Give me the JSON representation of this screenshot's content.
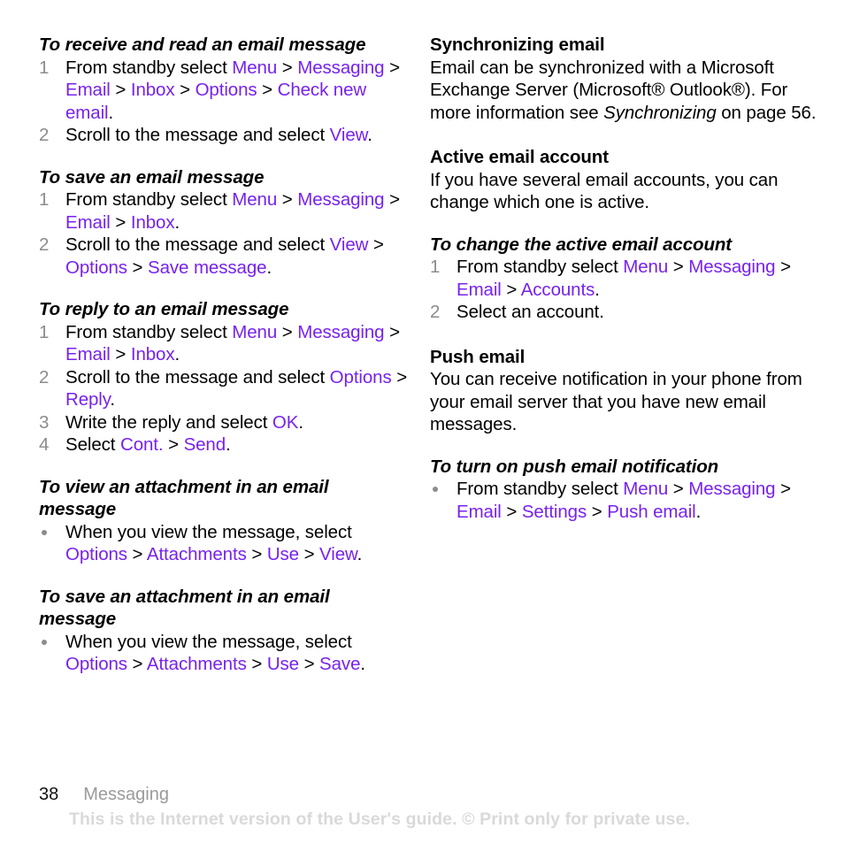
{
  "page": {
    "number": "38",
    "chapter": "Messaging",
    "watermark": "This is the Internet version of the User's guide. © Print only for private use."
  },
  "colors": {
    "menu_item": "#7722ee",
    "step_number": "#8c8c8c",
    "chapter_gray": "#9a9a9a",
    "watermark_gray": "#d9d9d9",
    "body_text": "#000000"
  },
  "left_column": {
    "sections": [
      {
        "heading": "To receive and read an email message",
        "heading_style": "bold-italic",
        "list_type": "ordered",
        "steps": [
          {
            "number": "1",
            "parts": [
              {
                "t": "From standby select ",
                "k": "plain"
              },
              {
                "t": "Menu",
                "k": "menu"
              },
              {
                "t": " > ",
                "k": "sep"
              },
              {
                "t": "Messaging",
                "k": "menu"
              },
              {
                "t": " > ",
                "k": "sep"
              },
              {
                "t": "Email",
                "k": "menu"
              },
              {
                "t": " > ",
                "k": "sep"
              },
              {
                "t": "Inbox",
                "k": "menu"
              },
              {
                "t": " > ",
                "k": "sep"
              },
              {
                "t": "Options",
                "k": "menu"
              },
              {
                "t": " > ",
                "k": "sep"
              },
              {
                "t": "Check new email",
                "k": "menu"
              },
              {
                "t": ".",
                "k": "plain"
              }
            ]
          },
          {
            "number": "2",
            "parts": [
              {
                "t": "Scroll to the message and select ",
                "k": "plain"
              },
              {
                "t": "View",
                "k": "menu"
              },
              {
                "t": ".",
                "k": "plain"
              }
            ]
          }
        ]
      },
      {
        "heading": "To save an email message",
        "heading_style": "bold-italic",
        "list_type": "ordered",
        "steps": [
          {
            "number": "1",
            "parts": [
              {
                "t": "From standby select ",
                "k": "plain"
              },
              {
                "t": "Menu",
                "k": "menu"
              },
              {
                "t": " > ",
                "k": "sep"
              },
              {
                "t": "Messaging",
                "k": "menu"
              },
              {
                "t": " > ",
                "k": "sep"
              },
              {
                "t": "Email",
                "k": "menu"
              },
              {
                "t": " > ",
                "k": "sep"
              },
              {
                "t": "Inbox",
                "k": "menu"
              },
              {
                "t": ".",
                "k": "plain"
              }
            ]
          },
          {
            "number": "2",
            "parts": [
              {
                "t": "Scroll to the message and select ",
                "k": "plain"
              },
              {
                "t": "View",
                "k": "menu"
              },
              {
                "t": " > ",
                "k": "sep"
              },
              {
                "t": "Options",
                "k": "menu"
              },
              {
                "t": " > ",
                "k": "sep"
              },
              {
                "t": "Save message",
                "k": "menu"
              },
              {
                "t": ".",
                "k": "plain"
              }
            ]
          }
        ]
      },
      {
        "heading": "To reply to an email message",
        "heading_style": "bold-italic",
        "list_type": "ordered",
        "steps": [
          {
            "number": "1",
            "parts": [
              {
                "t": "From standby select ",
                "k": "plain"
              },
              {
                "t": "Menu",
                "k": "menu"
              },
              {
                "t": " > ",
                "k": "sep"
              },
              {
                "t": "Messaging",
                "k": "menu"
              },
              {
                "t": " > ",
                "k": "sep"
              },
              {
                "t": "Email",
                "k": "menu"
              },
              {
                "t": " > ",
                "k": "sep"
              },
              {
                "t": "Inbox",
                "k": "menu"
              },
              {
                "t": ".",
                "k": "plain"
              }
            ]
          },
          {
            "number": "2",
            "parts": [
              {
                "t": "Scroll to the message and select ",
                "k": "plain"
              },
              {
                "t": "Options",
                "k": "menu"
              },
              {
                "t": " > ",
                "k": "sep"
              },
              {
                "t": "Reply",
                "k": "menu"
              },
              {
                "t": ".",
                "k": "plain"
              }
            ]
          },
          {
            "number": "3",
            "parts": [
              {
                "t": "Write the reply and select ",
                "k": "plain"
              },
              {
                "t": "OK",
                "k": "menu"
              },
              {
                "t": ".",
                "k": "plain"
              }
            ]
          },
          {
            "number": "4",
            "parts": [
              {
                "t": "Select ",
                "k": "plain"
              },
              {
                "t": "Cont.",
                "k": "menu"
              },
              {
                "t": " > ",
                "k": "sep"
              },
              {
                "t": "Send",
                "k": "menu"
              },
              {
                "t": ".",
                "k": "plain"
              }
            ]
          }
        ]
      },
      {
        "heading": "To view an attachment in an email message",
        "heading_style": "bold-italic",
        "list_type": "bullet",
        "steps": [
          {
            "number": "",
            "parts": [
              {
                "t": "When you view the message, select ",
                "k": "plain"
              },
              {
                "t": "Options",
                "k": "menu"
              },
              {
                "t": " > ",
                "k": "sep"
              },
              {
                "t": "Attachments",
                "k": "menu"
              },
              {
                "t": " > ",
                "k": "sep"
              },
              {
                "t": "Use",
                "k": "menu"
              },
              {
                "t": " > ",
                "k": "sep"
              },
              {
                "t": "View",
                "k": "menu"
              },
              {
                "t": ".",
                "k": "plain"
              }
            ]
          }
        ]
      },
      {
        "heading": "To save an attachment in an email message",
        "heading_style": "bold-italic",
        "list_type": "bullet",
        "steps": [
          {
            "number": "",
            "parts": [
              {
                "t": "When you view the message, select ",
                "k": "plain"
              },
              {
                "t": "Options",
                "k": "menu"
              },
              {
                "t": " > ",
                "k": "sep"
              },
              {
                "t": "Attachments",
                "k": "menu"
              },
              {
                "t": " > ",
                "k": "sep"
              },
              {
                "t": "Use",
                "k": "menu"
              },
              {
                "t": " > ",
                "k": "sep"
              },
              {
                "t": "Save",
                "k": "menu"
              },
              {
                "t": ".",
                "k": "plain"
              }
            ]
          }
        ]
      }
    ]
  },
  "right_column": {
    "sections": [
      {
        "heading": "Synchronizing email",
        "heading_style": "bold",
        "paragraph_parts": [
          {
            "t": "Email can be synchronized with a Microsoft Exchange Server (Microsoft® Outlook®). For more information see ",
            "k": "plain"
          },
          {
            "t": "Synchronizing",
            "k": "italic"
          },
          {
            "t": " on page 56.",
            "k": "plain"
          }
        ]
      },
      {
        "heading": "Active email account",
        "heading_style": "bold",
        "paragraph_parts": [
          {
            "t": "If you have several email accounts, you can change which one is active.",
            "k": "plain"
          }
        ]
      },
      {
        "heading": "To change the active email account",
        "heading_style": "bold-italic",
        "list_type": "ordered",
        "steps": [
          {
            "number": "1",
            "parts": [
              {
                "t": "From standby select ",
                "k": "plain"
              },
              {
                "t": "Menu",
                "k": "menu"
              },
              {
                "t": " > ",
                "k": "sep"
              },
              {
                "t": "Messaging",
                "k": "menu"
              },
              {
                "t": " > ",
                "k": "sep"
              },
              {
                "t": "Email",
                "k": "menu"
              },
              {
                "t": " > ",
                "k": "sep"
              },
              {
                "t": "Accounts",
                "k": "menu"
              },
              {
                "t": ".",
                "k": "plain"
              }
            ]
          },
          {
            "number": "2",
            "parts": [
              {
                "t": "Select an account.",
                "k": "plain"
              }
            ]
          }
        ]
      },
      {
        "heading": "Push email",
        "heading_style": "bold",
        "paragraph_parts": [
          {
            "t": "You can receive notification in your phone from your email server that you have new email messages.",
            "k": "plain"
          }
        ]
      },
      {
        "heading": "To turn on push email notification",
        "heading_style": "bold-italic",
        "list_type": "bullet",
        "steps": [
          {
            "number": "",
            "parts": [
              {
                "t": "From standby select ",
                "k": "plain"
              },
              {
                "t": "Menu",
                "k": "menu"
              },
              {
                "t": " > ",
                "k": "sep"
              },
              {
                "t": "Messaging",
                "k": "menu"
              },
              {
                "t": " > ",
                "k": "sep"
              },
              {
                "t": "Email",
                "k": "menu"
              },
              {
                "t": " > ",
                "k": "sep"
              },
              {
                "t": "Settings",
                "k": "menu"
              },
              {
                "t": " > ",
                "k": "sep"
              },
              {
                "t": "Push email",
                "k": "menu"
              },
              {
                "t": ".",
                "k": "plain"
              }
            ]
          }
        ]
      }
    ]
  }
}
